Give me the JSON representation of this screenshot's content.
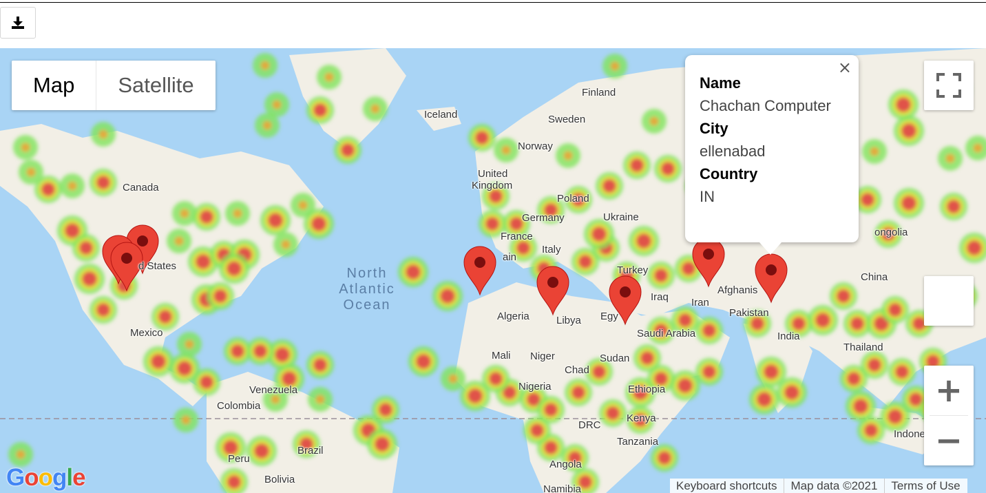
{
  "download_icon": "download-icon",
  "map": {
    "type_buttons": {
      "map": "Map",
      "satellite": "Satellite"
    },
    "ocean_label": [
      "North",
      "Atlantic",
      "Ocean"
    ],
    "labels": {
      "finland": "Finland",
      "iceland": "Iceland",
      "sweden": "Sweden",
      "norway": "Norway",
      "united": "United",
      "kingdom": "Kingdom",
      "canada": "Canada",
      "poland": "Poland",
      "germany": "Germany",
      "ukraine": "Ukraine",
      "france": "France",
      "italy": "Italy",
      "turkey": "Turkey",
      "states": "d States",
      "mexico": "Mexico",
      "algeria": "Algeria",
      "libya": "Libya",
      "egypt": "Egy",
      "iraq": "Iraq",
      "iran": "Iran",
      "afghanistan": "Afghanis",
      "pakistan": "Pakistan",
      "china": "China",
      "mongolia": "ongolia",
      "india": "India",
      "saudi": "Saudi Arabia",
      "thailand": "Thailand",
      "mali": "Mali",
      "niger": "Niger",
      "sudan": "Sudan",
      "chad": "Chad",
      "venezuela": "Venezuela",
      "colombia": "Colombia",
      "nigeria": "Nigeria",
      "ethiopia": "Ethiopia",
      "drc": "DRC",
      "kenya": "Kenya",
      "tanzania": "Tanzania",
      "peru": "Peru",
      "brazil": "Brazil",
      "bolivia": "Bolivia",
      "angola": "Angola",
      "namibia": "Namibia",
      "indonesia": "Indone",
      "spain": "ain"
    },
    "marker_icon": "map-pin-icon",
    "fullscreen_icon": "fullscreen-icon",
    "zoom_in": "+",
    "zoom_out": "−",
    "google_logo": "Google",
    "attribution": {
      "shortcuts": "Keyboard shortcuts",
      "data": "Map data ©2021",
      "terms": "Terms of Use"
    },
    "colors": {
      "water": "#a9d4f5",
      "land": "#f2efe6",
      "heat_low": "#7fe35a",
      "heat_mid": "#e8e53a",
      "heat_high": "#e04b4b",
      "pin": "#ea4335"
    }
  },
  "popup": {
    "close": "×",
    "name_label": "Name",
    "name_value": "Chachan Computer",
    "city_label": "City",
    "city_value": "ellenabad",
    "country_label": "Country",
    "country_value": "IN"
  }
}
